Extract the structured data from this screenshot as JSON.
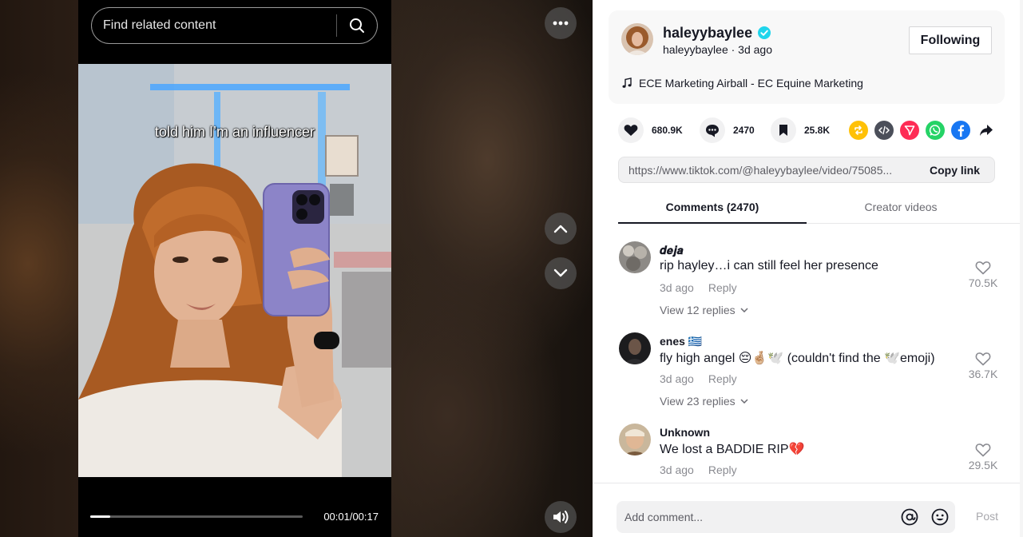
{
  "search": {
    "placeholder": "Find related content"
  },
  "video": {
    "caption": "told him I’m an influencer",
    "time": "00:01/00:17",
    "progress": 0.095
  },
  "author": {
    "name": "haleyybaylee",
    "sub": "haleyybaylee · 3d ago",
    "follow_label": "Following",
    "music": "ECE Marketing Airball - EC Equine Marketing"
  },
  "actions": {
    "likes": "680.9K",
    "comments": "2470",
    "saves": "25.8K"
  },
  "share_icons": [
    "repost-icon",
    "embed-icon",
    "send-icon",
    "whatsapp-icon",
    "facebook-icon",
    "share-arrow-icon"
  ],
  "link": {
    "url": "https://www.tiktok.com/@haleyybaylee/video/75085...",
    "copy_label": "Copy link"
  },
  "tabs": [
    {
      "label": "Comments (2470)"
    },
    {
      "label": "Creator videos"
    }
  ],
  "comments": [
    {
      "user": "𝒅𝒆𝒋𝒂",
      "text": "rip hayley…i can still feel her presence",
      "time": "3d ago",
      "reply": "Reply",
      "replies": "View 12 replies",
      "likes": "70.5K"
    },
    {
      "user": "enes 🇬🇷",
      "text": "fly high angel 😔🤞🏼🕊️ (couldn't find the 🕊️emoji)",
      "time": "3d ago",
      "reply": "Reply",
      "replies": "View 23 replies",
      "likes": "36.7K"
    },
    {
      "user": "Unknown",
      "text": "We lost a BADDIE RIP💔",
      "time": "3d ago",
      "reply": "Reply",
      "replies": "",
      "likes": "29.5K"
    }
  ],
  "comment_box": {
    "placeholder": "Add comment...",
    "post_label": "Post"
  },
  "colors": {
    "verified": "#20d5ec",
    "whatsapp": "#25d366",
    "facebook": "#1877f2",
    "repost": "#ffc107",
    "send": "#fe2c55"
  }
}
